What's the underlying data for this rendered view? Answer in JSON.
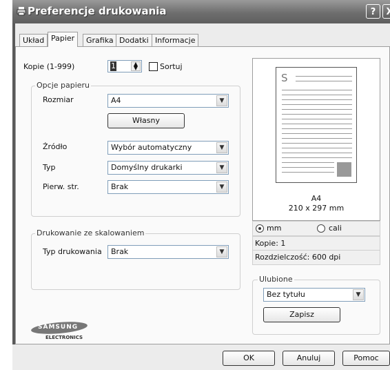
{
  "window": {
    "title": "Preferencje drukowania",
    "help_glyph": "?",
    "close_glyph": "X"
  },
  "tabs": [
    {
      "label": "Układ",
      "active": false
    },
    {
      "label": "Papier",
      "active": true
    },
    {
      "label": "Grafika",
      "active": false
    },
    {
      "label": "Dodatki",
      "active": false
    },
    {
      "label": "Informacje",
      "active": false
    }
  ],
  "copies": {
    "label": "Kopie (1-999)",
    "value": "1",
    "collate_label": "Sortuj",
    "collate_checked": false
  },
  "paper_options": {
    "group_label": "Opcje papieru",
    "size_label": "Rozmiar",
    "size_value": "A4",
    "custom_button": "Własny",
    "source_label": "Źródło",
    "source_value": "Wybór automatyczny",
    "type_label": "Typ",
    "type_value": "Domyślny drukarki",
    "first_page_label": "Pierw. str.",
    "first_page_value": "Brak"
  },
  "scaling": {
    "group_label": "Drukowanie ze skalowaniem",
    "type_label": "Typ drukowania",
    "type_value": "Brak"
  },
  "logo": {
    "brand": "SAMSUNG",
    "sub": "ELECTRONICS"
  },
  "preview": {
    "page_letter": "S",
    "paper_name": "A4",
    "paper_dims": "210 x 297 mm",
    "unit_mm": "mm",
    "unit_in": "cali",
    "unit_selected": "mm",
    "copies_text": "Kopie: 1",
    "resolution_text": "Rozdzielczość: 600 dpi"
  },
  "favorites": {
    "group_label": "Ulubione",
    "value": "Bez tytułu",
    "save_button": "Zapisz"
  },
  "buttons": {
    "ok": "OK",
    "cancel": "Anuluj",
    "help": "Pomoc"
  },
  "colors": {
    "titlebar": "#6e6e6e",
    "panel": "#fafafa",
    "dialog": "#ececec"
  }
}
